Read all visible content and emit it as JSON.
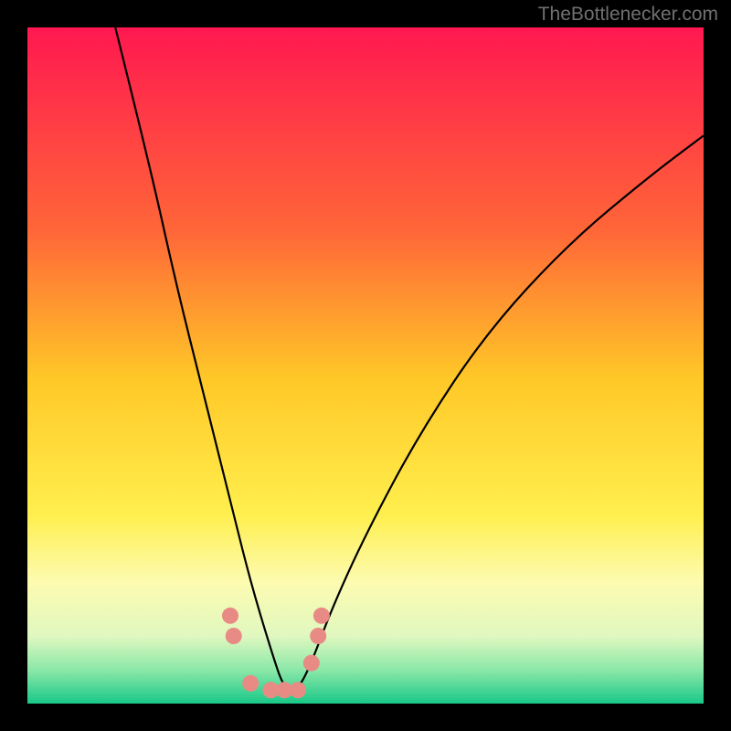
{
  "watermark": "TheBottlenecker.com",
  "chart_data": {
    "type": "line",
    "title": "",
    "xlabel": "",
    "ylabel": "",
    "xlim": [
      0,
      100
    ],
    "ylim": [
      0,
      100
    ],
    "series": [
      {
        "name": "bottleneck-curve",
        "description": "V-shaped bottleneck percentage curve reaching minimum near x≈38, asymmetric with steeper left branch",
        "x": [
          13,
          18,
          22,
          26,
          30,
          33,
          36,
          38,
          40,
          42,
          45,
          50,
          58,
          68,
          80,
          92,
          100
        ],
        "y": [
          100,
          80,
          62,
          46,
          30,
          18,
          8,
          2,
          2,
          6,
          14,
          25,
          40,
          55,
          68,
          78,
          84
        ]
      }
    ],
    "highlighted_points": {
      "description": "Salmon-colored marker points near the curve minimum",
      "x": [
        30,
        30.5,
        33,
        36,
        38,
        40,
        42,
        43,
        43.5
      ],
      "y": [
        13,
        10,
        3,
        2,
        2,
        2,
        6,
        10,
        13
      ]
    },
    "background": {
      "description": "Vertical gradient representing bottleneck severity: red (bad) at top through orange/yellow to light-yellow then green/teal (good) at bottom",
      "stops": [
        {
          "pos": 0,
          "color": "#ff1850"
        },
        {
          "pos": 30,
          "color": "#ff6638"
        },
        {
          "pos": 52,
          "color": "#ffc827"
        },
        {
          "pos": 72,
          "color": "#ffef4e"
        },
        {
          "pos": 82,
          "color": "#fdfbb0"
        },
        {
          "pos": 90,
          "color": "#e0f8c0"
        },
        {
          "pos": 95,
          "color": "#8ce8a8"
        },
        {
          "pos": 100,
          "color": "#18c888"
        }
      ]
    }
  }
}
